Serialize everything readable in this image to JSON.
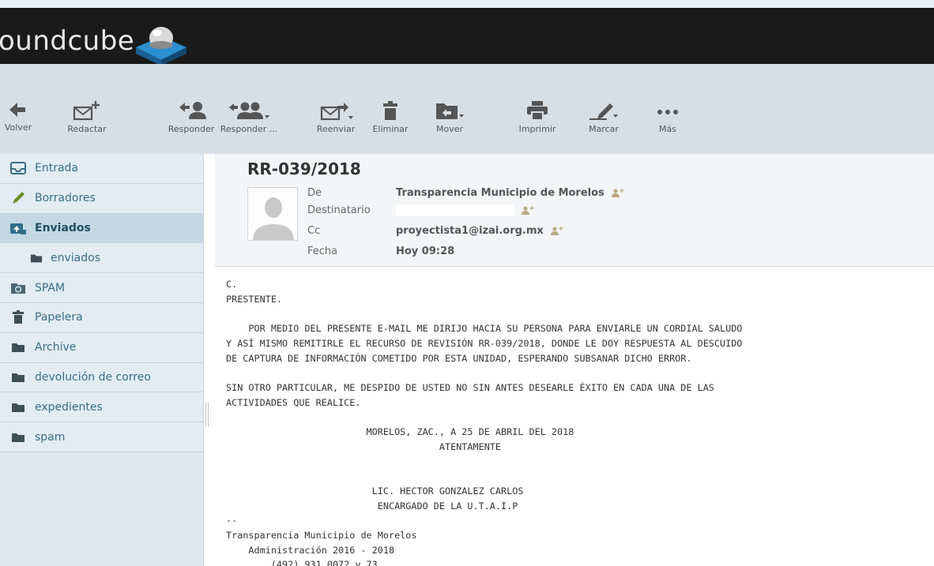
{
  "app": {
    "logo_text": "oundcube"
  },
  "toolbar": {
    "back": "Volver",
    "compose": "Redactar",
    "reply": "Responder",
    "reply_all": "Responder ...",
    "forward": "Reenviar",
    "delete": "Eliminar",
    "move": "Mover",
    "print": "Imprimir",
    "mark": "Marcar",
    "more": "Más"
  },
  "folders": [
    {
      "label": "Entrada",
      "icon": "inbox-icon"
    },
    {
      "label": "Borradores",
      "icon": "pencil-icon"
    },
    {
      "label": "Enviados",
      "icon": "sent-icon",
      "selected": true
    },
    {
      "label": "enviados",
      "icon": "folder-icon",
      "sub": true
    },
    {
      "label": "SPAM",
      "icon": "junk-icon"
    },
    {
      "label": "Papelera",
      "icon": "trash-icon"
    },
    {
      "label": "Archive",
      "icon": "folder-icon"
    },
    {
      "label": "devolución de correo",
      "icon": "folder-icon"
    },
    {
      "label": "expedientes",
      "icon": "folder-icon"
    },
    {
      "label": "spam",
      "icon": "folder-icon"
    }
  ],
  "message": {
    "subject": "RR-039/2018",
    "headers": {
      "from_label": "De",
      "from_value": "Transparencia Municipio de Morelos",
      "to_label": "Destinatario",
      "to_value": "",
      "cc_label": "Cc",
      "cc_value": "proyectista1@izai.org.mx",
      "date_label": "Fecha",
      "date_value": "Hoy 09:28"
    },
    "body": "C.\nPRESTENTE.\n\n    POR MEDIO DEL PRESENTE E-MAIL ME DIRIJO HACIA SU PERSONA PARA ENVIARLE UN CORDIAL SALUDO\nY ASÍ MISMO REMITIRLE EL RECURSO DE REVISIÓN RR-039/2018, DONDE LE DOY RESPUESTA AL DESCUIDO\nDE CAPTURA DE INFORMACIÓN COMETIDO POR ESTA UNIDAD, ESPERANDO SUBSANAR DICHO ERROR.\n\nSIN OTRO PARTICULAR, ME DESPIDO DE USTED NO SIN ANTES DESEARLE ÉXITO EN CADA UNA DE LAS\nACTIVIDADES QUE REALICE.\n\n                         MORELOS, ZAC., A 25 DE ABRIL DEL 2018\n                                      ATENTAMENTE\n\n\n                          LIC. HECTOR GONZALEZ CARLOS\n                           ENCARGADO DE LA U.T.A.I.P\n--\nTransparencia Municipio de Morelos\n    Administración 2016 - 2018\n        (492) 931 0072 y 73"
  },
  "colors": {
    "header_bg": "#1a1a1a",
    "toolbar_bg": "#d8dfe4",
    "sidebar_bg": "#e2ecf2",
    "selected_bg": "#c4d8e3",
    "link": "#3a6e85"
  }
}
